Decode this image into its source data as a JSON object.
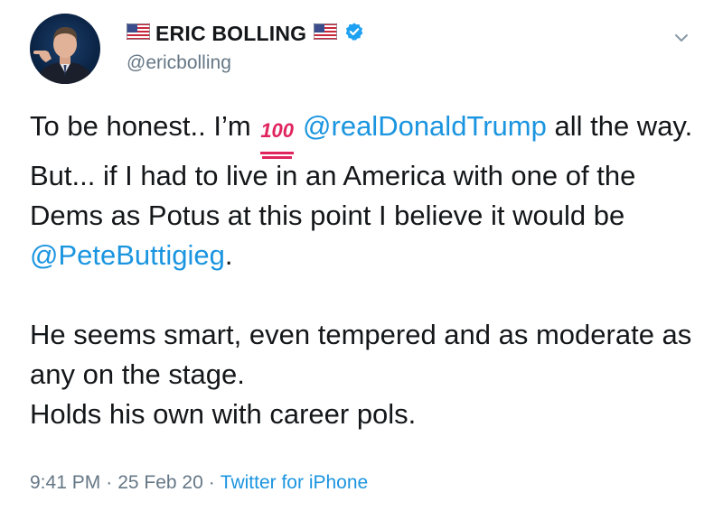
{
  "user": {
    "display_name": "ERIC BOLLING",
    "handle": "@ericbolling",
    "verified": true,
    "name_flag_icon": "us-flag-icon"
  },
  "tweet": {
    "line1_pre": "To be honest.. I’m",
    "emoji": "100",
    "mention_trump": "@realDonaldTrump",
    "line1_post": "all the way.",
    "line2": "But... if I had to live in an America with one of the Dems as Potus at this point I believe it would be",
    "mention_pete": "@PeteButtigieg",
    "line2_end": ".",
    "para2_line1": "He seems smart, even tempered and as moderate as any on the stage.",
    "para2_line2": "Holds his own with career pols."
  },
  "meta": {
    "time": "9:41 PM",
    "separator": "·",
    "date": "25 Feb 20",
    "source": "Twitter for iPhone"
  },
  "colors": {
    "link": "#1b95e0",
    "secondary_text": "#657786",
    "verified_badge": "#1da1f2",
    "emoji_red": "#e0245e"
  }
}
